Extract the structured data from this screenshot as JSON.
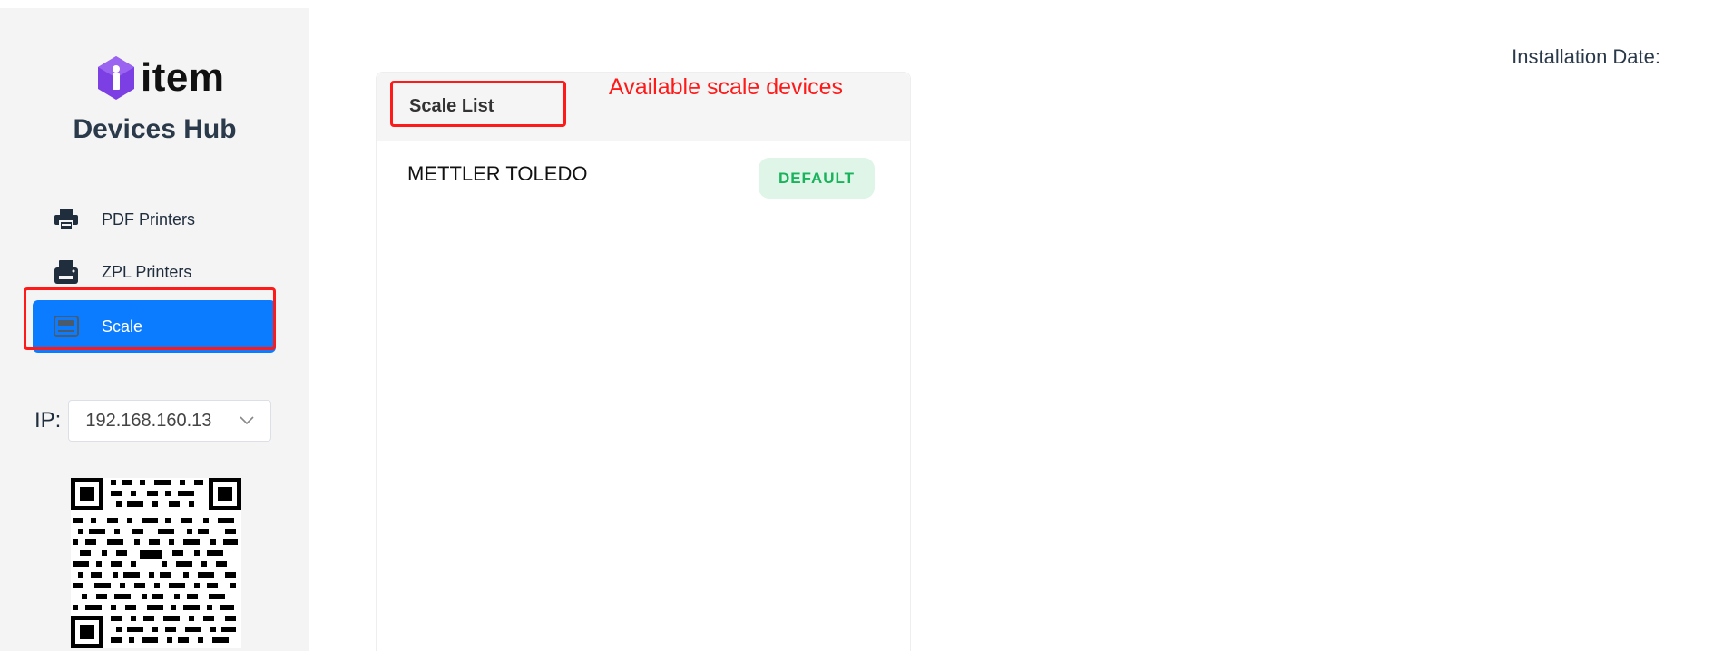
{
  "brand": {
    "logo_text": "item",
    "app_title": "Devices Hub"
  },
  "nav": {
    "items": [
      {
        "label": "PDF Printers",
        "icon": "printer-icon"
      },
      {
        "label": "ZPL Printers",
        "icon": "label-printer-icon"
      },
      {
        "label": "Scale",
        "icon": "scale-icon",
        "active": true
      }
    ]
  },
  "ip": {
    "label": "IP:",
    "value": "192.168.160.13"
  },
  "header": {
    "installation_date_label": "Installation Date:"
  },
  "scale_list": {
    "title": "Scale List",
    "annotation": "Available scale devices",
    "devices": [
      {
        "name": "METTLER TOLEDO",
        "badge": "DEFAULT"
      }
    ]
  },
  "colors": {
    "accent": "#0b7bff",
    "annotation": "#ff1a1a",
    "badge_bg": "#dff5e8",
    "badge_text": "#19b35c",
    "logo_purple": "#7b3fe4"
  }
}
